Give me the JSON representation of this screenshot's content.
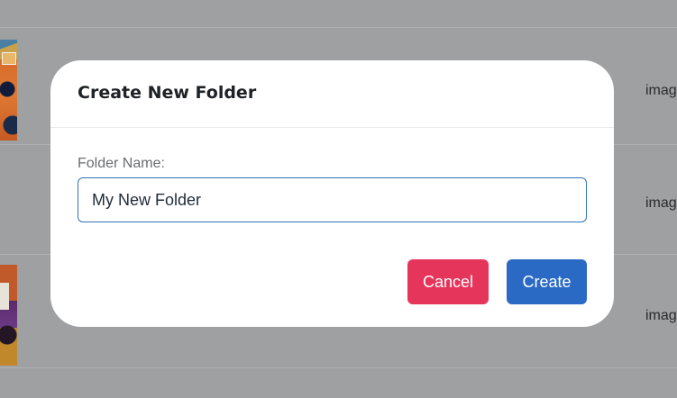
{
  "background": {
    "rows": [
      {
        "text": "imag"
      },
      {
        "text": "imag"
      },
      {
        "text": "imag"
      }
    ]
  },
  "modal": {
    "title": "Create New Folder",
    "field_label": "Folder Name:",
    "input_value": "My New Folder",
    "cancel_label": "Cancel",
    "create_label": "Create"
  },
  "colors": {
    "overlay": "#9fa0a2",
    "cancel": "#e5355a",
    "create": "#2a69c4",
    "input_border": "#2f74b8"
  }
}
